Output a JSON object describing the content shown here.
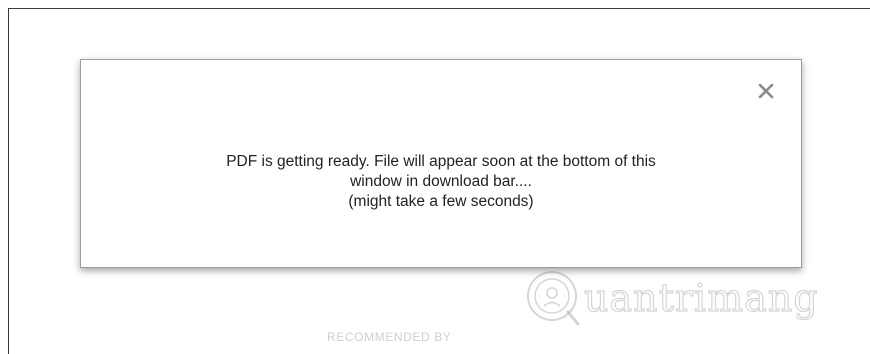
{
  "modal": {
    "close_label": "×",
    "message_lines": [
      "PDF is getting ready. File will appear soon at the bottom of this",
      "window in download bar....",
      "(might take a few seconds)"
    ]
  },
  "footer": {
    "recommended_label": "RECOMMENDED BY"
  },
  "watermark": {
    "text": "uantrimang"
  },
  "icons": {
    "close": "close-icon",
    "watermark_logo": "quantrimang-logo-icon"
  }
}
